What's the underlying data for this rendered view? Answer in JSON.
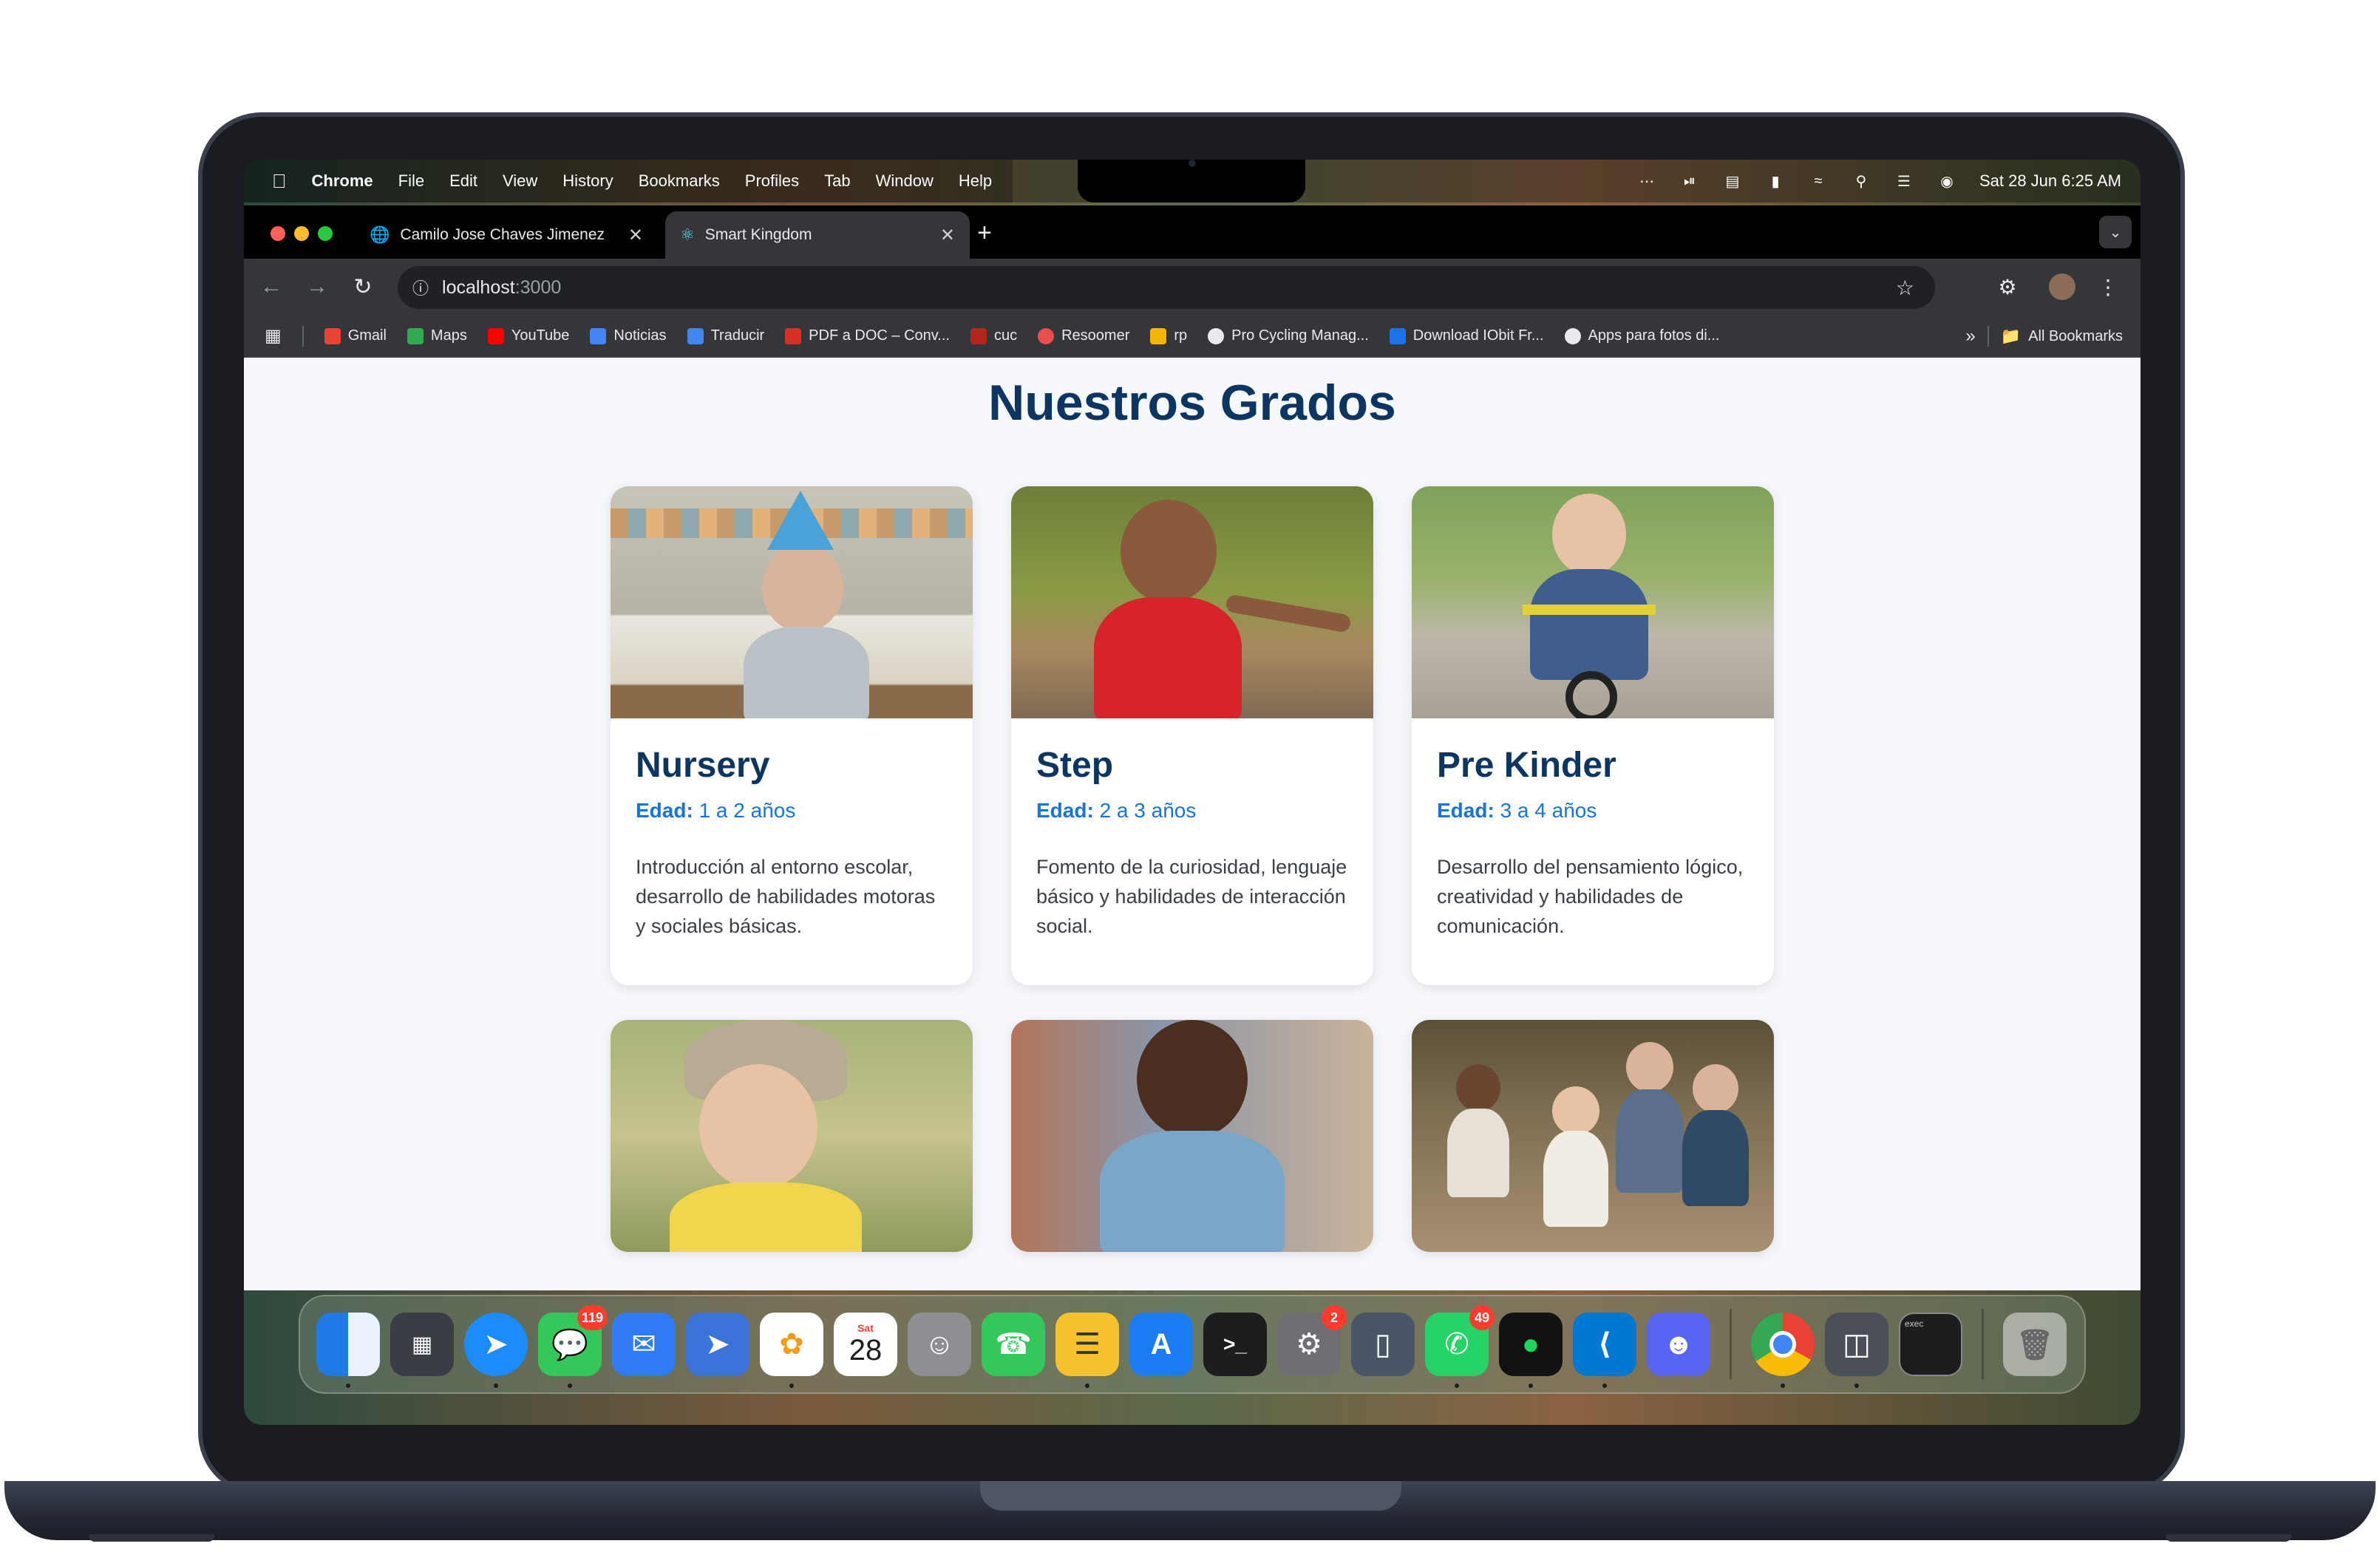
{
  "menubar": {
    "app": "Chrome",
    "menus": [
      "File",
      "Edit",
      "View",
      "History",
      "Bookmarks",
      "Profiles",
      "Tab",
      "Window",
      "Help"
    ],
    "clock": "Sat 28 Jun  6:25 AM"
  },
  "tabs": [
    {
      "title": "Camilo Jose Chaves Jimenez",
      "active": false
    },
    {
      "title": "Smart Kingdom",
      "active": true
    }
  ],
  "omnibox": {
    "host": "localhost",
    "port": ":3000"
  },
  "bookmarks": [
    {
      "label": "Gmail",
      "color": "#ea4335"
    },
    {
      "label": "Maps",
      "color": "#34a853"
    },
    {
      "label": "YouTube",
      "color": "#ff0000"
    },
    {
      "label": "Noticias",
      "color": "#4285f4"
    },
    {
      "label": "Traducir",
      "color": "#4285f4"
    },
    {
      "label": "PDF a DOC – Conv...",
      "color": "#d93025"
    },
    {
      "label": "cuc",
      "color": "#b3261e"
    },
    {
      "label": "Resoomer",
      "color": "#e94f4f"
    },
    {
      "label": "rp",
      "color": "#f4b400"
    },
    {
      "label": "Pro Cycling Manag...",
      "color": "#e8eaed"
    },
    {
      "label": "Download IObit Fr...",
      "color": "#1a73e8"
    },
    {
      "label": "Apps para fotos di...",
      "color": "#e8eaed"
    }
  ],
  "all_bookmarks": "All Bookmarks",
  "page": {
    "title": "Nuestros Grados",
    "age_label": "Edad:",
    "cards": [
      {
        "name": "Nursery",
        "age": "1 a 2 años",
        "desc": "Introducción al entorno escolar, desarrollo de habilidades motoras y sociales básicas."
      },
      {
        "name": "Step",
        "age": "2 a 3 años",
        "desc": "Fomento de la curiosidad, lenguaje básico y habilidades de interacción social."
      },
      {
        "name": "Pre Kinder",
        "age": "3 a 4 años",
        "desc": "Desarrollo del pensamiento lógico, creatividad y habilidades de comunicación."
      }
    ]
  },
  "dock": {
    "calendar_month": "Sat",
    "calendar_day": "28",
    "badges": {
      "messages": "119",
      "settings": "2",
      "whatsapp": "49"
    },
    "terminal_prompt": ">_",
    "exec_label": "exec"
  },
  "colors": {
    "title": "#0c3561",
    "accent": "#1a73d9",
    "page_bg": "#f6f8fc"
  }
}
